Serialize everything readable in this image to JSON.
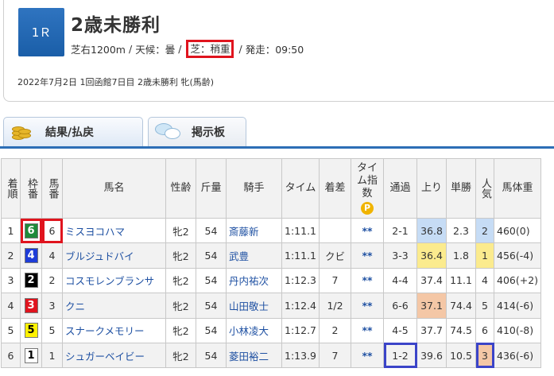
{
  "race": {
    "number": "1Ｒ",
    "title": "2歳未勝利",
    "course": "芝右1200m",
    "weather": "天候：曇",
    "track": "芝：稍重",
    "start": "発走：09:50",
    "separator": "/",
    "meta": "2022年7月2日 1回函館7日目 2歳未勝利 牝(馬齢)"
  },
  "tabs": {
    "results": {
      "label": "結果/払戻",
      "icon": "coins-icon"
    },
    "board": {
      "label": "掲示板",
      "icon": "chat-bubble-icon"
    }
  },
  "colors": {
    "accent": "#2d6eb6",
    "highlight_red": "#e0141e",
    "highlight_blue": "#3b44c8",
    "rank1_blue": "#c6dcf5",
    "rank2_yellow": "#fbeb8e",
    "rank3_orange": "#f4c7a6"
  },
  "table": {
    "headers": {
      "rank": "着順",
      "frame": "枠番",
      "num": "馬番",
      "name": "馬名",
      "sex": "性齢",
      "weight": "斤量",
      "jockey": "騎手",
      "time": "タイム",
      "margin": "着差",
      "index": "タイム指数",
      "index_badge": "P",
      "passing": "通過",
      "last": "上り",
      "odds": "単勝",
      "pop": "人気",
      "body": "馬体重"
    },
    "rows": [
      {
        "rank": "1",
        "frame": "6",
        "num": "6",
        "name": "ミスヨコハマ",
        "sex": "牝2",
        "weight": "54",
        "jockey": "斎藤新",
        "time": "1:11.1",
        "margin": "",
        "index": "**",
        "passing": "2-1",
        "last": "36.8",
        "odds": "2.3",
        "pop": "2",
        "body": "460(0)"
      },
      {
        "rank": "2",
        "frame": "4",
        "num": "4",
        "name": "ブルジュドバイ",
        "sex": "牝2",
        "weight": "54",
        "jockey": "武豊",
        "time": "1:11.1",
        "margin": "クビ",
        "index": "**",
        "passing": "3-3",
        "last": "36.4",
        "odds": "1.8",
        "pop": "1",
        "body": "456(-4)"
      },
      {
        "rank": "3",
        "frame": "2",
        "num": "2",
        "name": "コスモレンブランサ",
        "sex": "牝2",
        "weight": "54",
        "jockey": "丹内祐次",
        "time": "1:12.3",
        "margin": "7",
        "index": "**",
        "passing": "4-4",
        "last": "37.4",
        "odds": "11.1",
        "pop": "4",
        "body": "406(+2)"
      },
      {
        "rank": "4",
        "frame": "3",
        "num": "3",
        "name": "クニ",
        "sex": "牝2",
        "weight": "54",
        "jockey": "山田敬士",
        "time": "1:12.4",
        "margin": "1/2",
        "index": "**",
        "passing": "6-6",
        "last": "37.1",
        "odds": "74.4",
        "pop": "5",
        "body": "414(-6)"
      },
      {
        "rank": "5",
        "frame": "5",
        "num": "5",
        "name": "スナークメモリー",
        "sex": "牝2",
        "weight": "54",
        "jockey": "小林凌大",
        "time": "1:12.7",
        "margin": "2",
        "index": "**",
        "passing": "4-5",
        "last": "37.7",
        "odds": "74.5",
        "pop": "6",
        "body": "410(-8)"
      },
      {
        "rank": "6",
        "frame": "1",
        "num": "1",
        "name": "シュガーベイビー",
        "sex": "牝2",
        "weight": "54",
        "jockey": "菱田裕二",
        "time": "1:13.9",
        "margin": "7",
        "index": "**",
        "passing": "1-2",
        "last": "39.6",
        "odds": "10.5",
        "pop": "3",
        "body": "436(-6)"
      }
    ]
  }
}
